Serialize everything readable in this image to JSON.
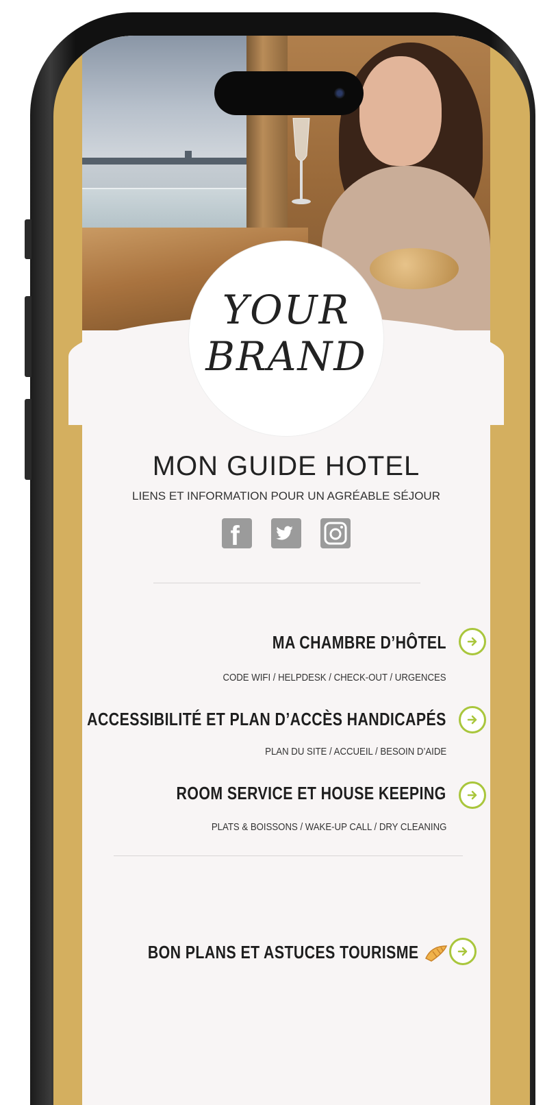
{
  "brand": {
    "line1": "YOUR",
    "line2": "BRAND"
  },
  "header": {
    "title": "MON GUIDE HOTEL",
    "subtitle": "LIENS ET INFORMATION POUR UN AGRÉABLE SÉJOUR"
  },
  "socials": [
    {
      "name": "facebook-icon",
      "glyph": "f"
    },
    {
      "name": "twitter-icon",
      "glyph": ""
    },
    {
      "name": "instagram-icon",
      "glyph": ""
    }
  ],
  "menu": [
    {
      "title": "MA CHAMBRE D’HÔTEL",
      "subtitle": "CODE WIFI / HELPDESK / CHECK-OUT / URGENCES"
    },
    {
      "title": "ACCESSIBILITÉ ET PLAN D’ACCÈS HANDICAPÉS",
      "subtitle": "PLAN DU SITE / ACCUEIL / BESOIN D’AIDE"
    },
    {
      "title": "ROOM SERVICE ET HOUSE KEEPING",
      "subtitle": "PLATS & BOISSONS / WAKE-UP CALL / DRY CLEANING"
    },
    {
      "title": "BON PLANS ET ASTUCES TOURISME",
      "subtitle": ""
    }
  ],
  "colors": {
    "accent": "#a9c63c",
    "frame_gold": "#d4af5f",
    "social_gray": "#9b9b9b"
  }
}
